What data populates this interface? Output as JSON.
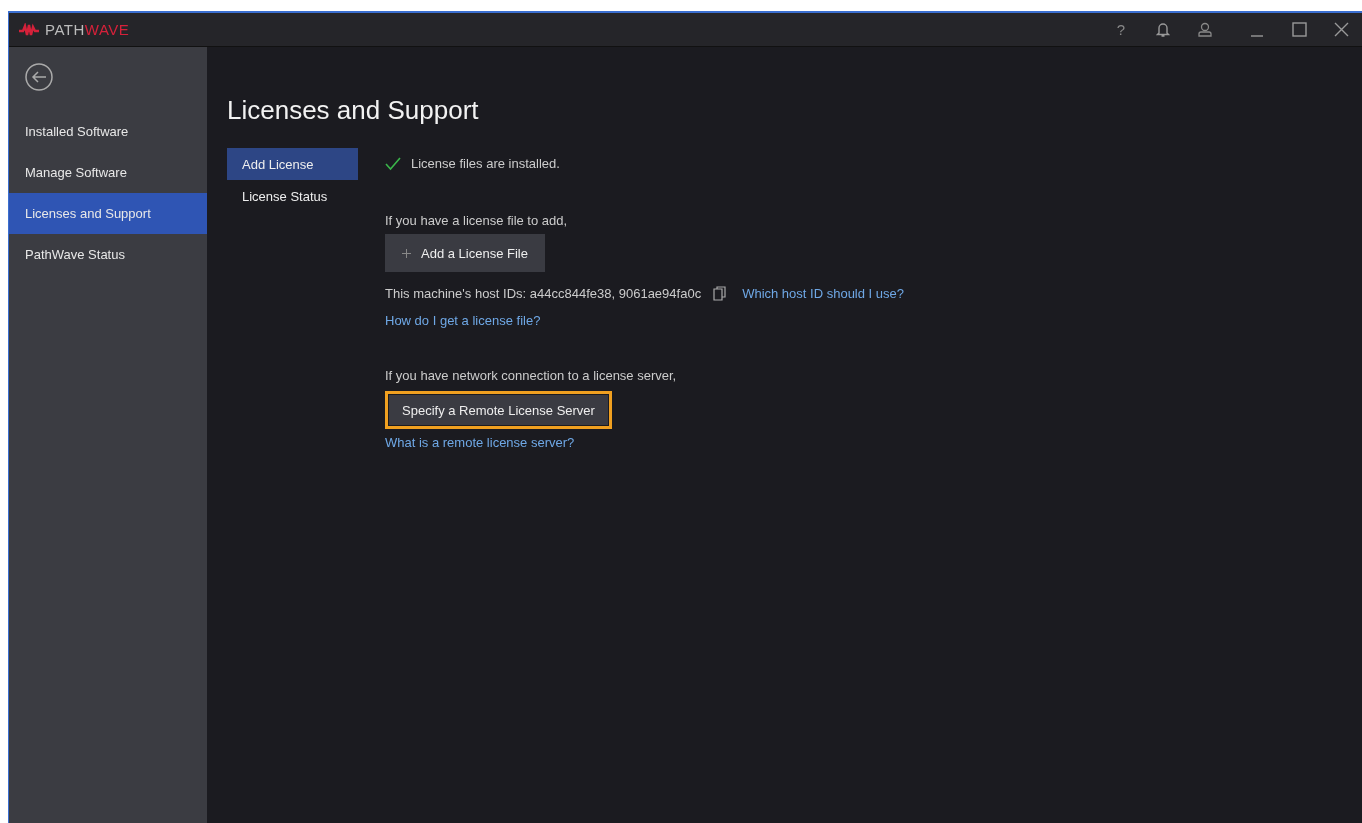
{
  "titlebar": {
    "logo": {
      "first": "PATH",
      "second": "WAVE"
    },
    "help": "?"
  },
  "sidebar": {
    "items": [
      {
        "label": "Installed Software",
        "selected": false
      },
      {
        "label": "Manage Software",
        "selected": false
      },
      {
        "label": "Licenses and Support",
        "selected": true
      },
      {
        "label": "PathWave Status",
        "selected": false
      }
    ]
  },
  "page": {
    "title": "Licenses and Support",
    "subnav": [
      {
        "label": "Add License",
        "selected": true
      },
      {
        "label": "License Status",
        "selected": false
      }
    ],
    "status": "License files are installed.",
    "file_section": {
      "intro": "If you have a license file to add,",
      "button": "Add a License File",
      "host_ids": "This machine's host IDs: a44cc844fe38, 9061ae94fa0c",
      "host_link": "Which host ID should I use?",
      "file_link": "How do I get a license file?"
    },
    "server_section": {
      "intro": "If you have network connection to a license server,",
      "button": "Specify a Remote License Server",
      "highlighted": true,
      "link": "What is a remote license server?"
    }
  }
}
